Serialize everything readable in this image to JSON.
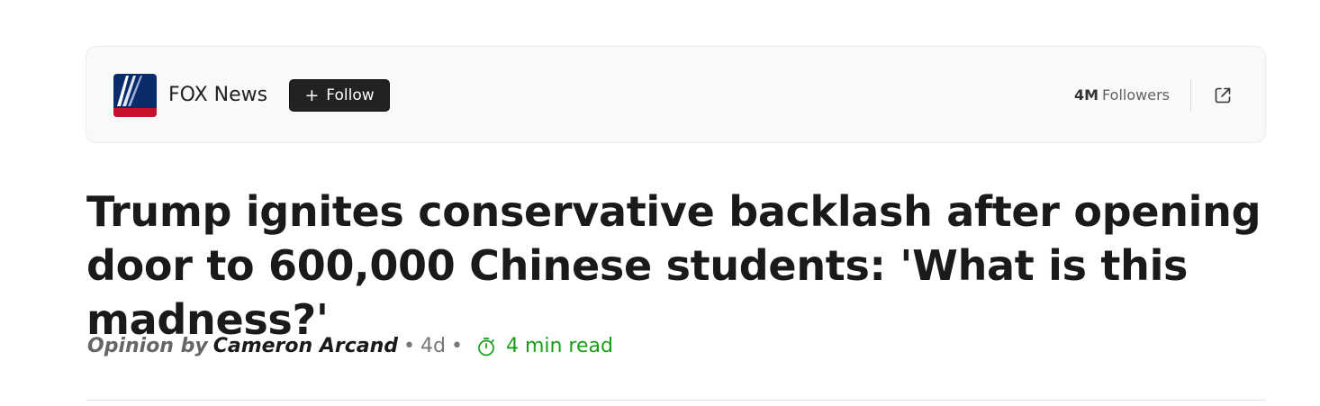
{
  "publisher": {
    "name": "FOX News",
    "logo_icon": "fox-news-logo",
    "follow_label": "Follow",
    "follow_icon": "plus-icon",
    "followers_count": "4M",
    "followers_label": "Followers",
    "external_icon": "external-link-icon"
  },
  "article": {
    "headline": "Trump ignites conservative backlash after opening door to 600,000 Chinese students: 'What is this madness?'",
    "opinion_label": "Opinion by",
    "author": "Cameron Arcand",
    "age": "4d",
    "separator": "•",
    "timer_icon": "stopwatch-icon",
    "read_time": "4 min read"
  },
  "colors": {
    "follow_bg": "#222222",
    "read_time": "#1a9e1a",
    "logo_blue": "#0a2c6b",
    "logo_red": "#c8102e"
  }
}
